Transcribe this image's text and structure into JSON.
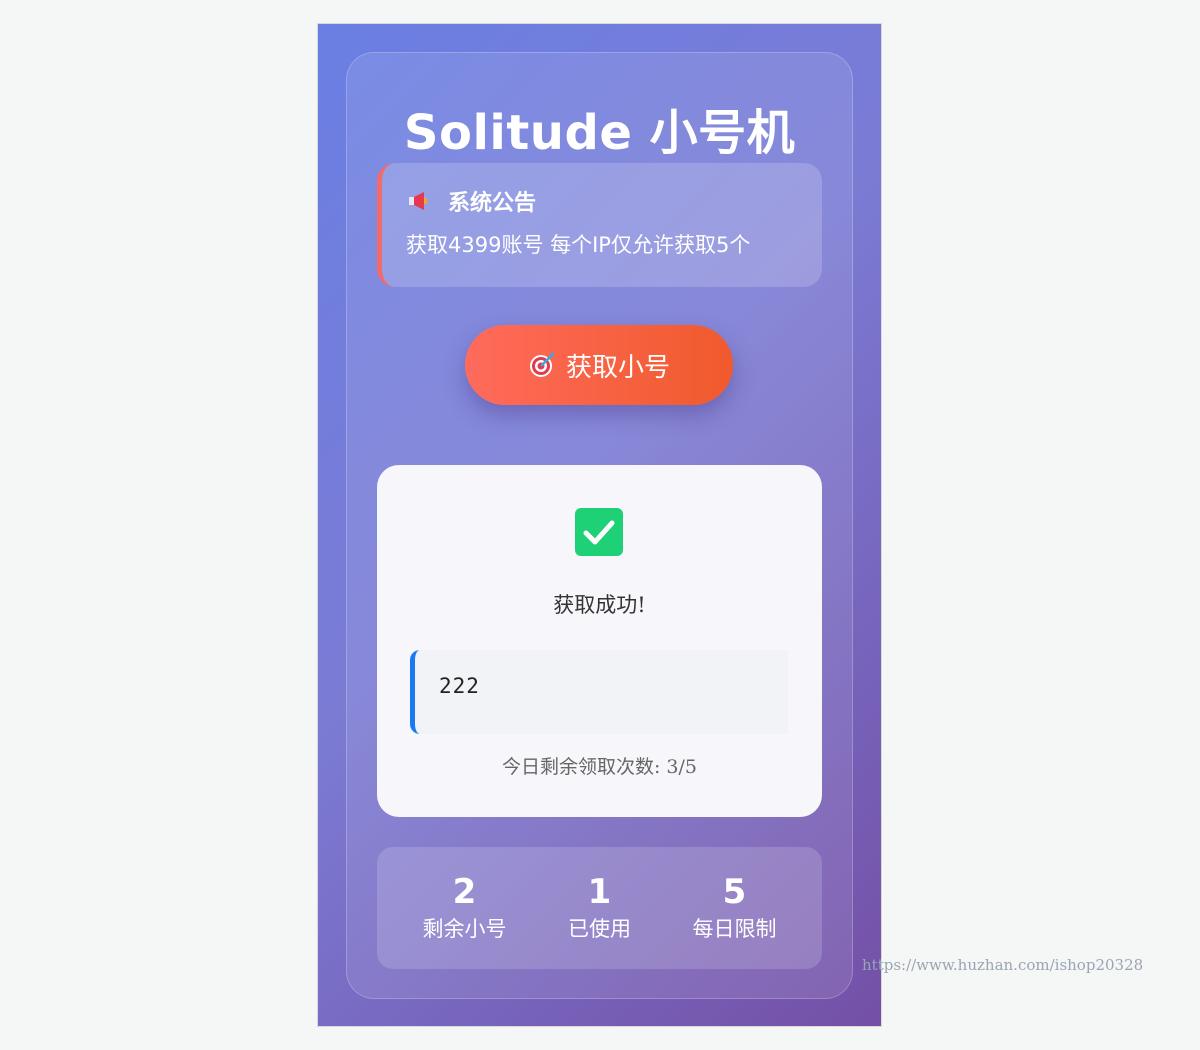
{
  "app": {
    "title": "Solitude 小号机"
  },
  "notice": {
    "icon": "megaphone-icon",
    "heading": "系统公告",
    "text": "获取4399账号 每个IP仅允许获取5个",
    "accent_color": "#f26b6b"
  },
  "action": {
    "icon": "target-icon",
    "button_label": "获取小号",
    "button_color": "#f05a2c"
  },
  "result": {
    "icon": "check-icon",
    "success_text": "获取成功!",
    "account": "222",
    "remaining_text": "今日剩余领取次数: 3/5",
    "remaining_count": 3,
    "daily_total": 5
  },
  "stats": [
    {
      "value": "2",
      "label": "剩余小号"
    },
    {
      "value": "1",
      "label": "已使用"
    },
    {
      "value": "5",
      "label": "每日限制"
    }
  ],
  "watermark": "https://www.huzhan.com/ishop20328"
}
